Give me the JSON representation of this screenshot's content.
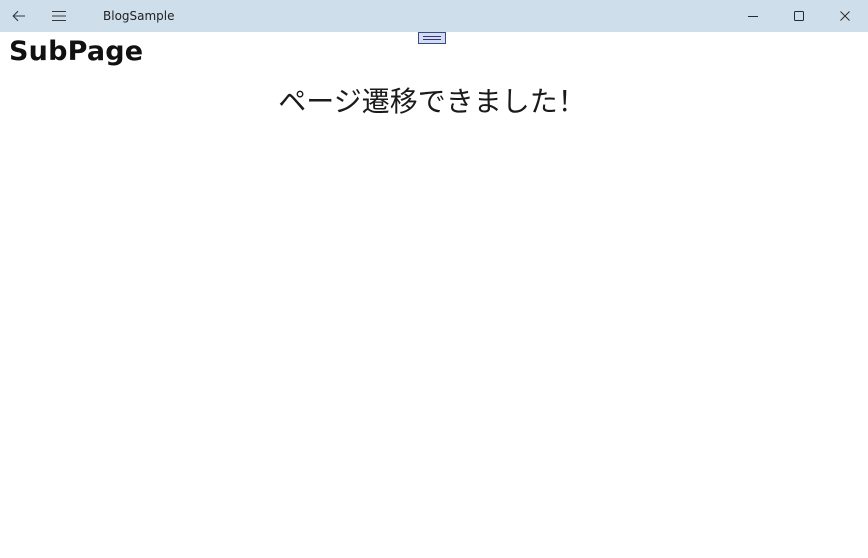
{
  "window": {
    "title": "BlogSample",
    "icons": {
      "back": "back-arrow-icon",
      "menu": "hamburger-menu-icon",
      "minimize": "minimize-icon",
      "maximize": "maximize-icon",
      "close": "close-icon"
    },
    "titlebar_color": "#cfdeeb"
  },
  "page": {
    "heading": "SubPage",
    "message": "ページ遷移できました！"
  }
}
